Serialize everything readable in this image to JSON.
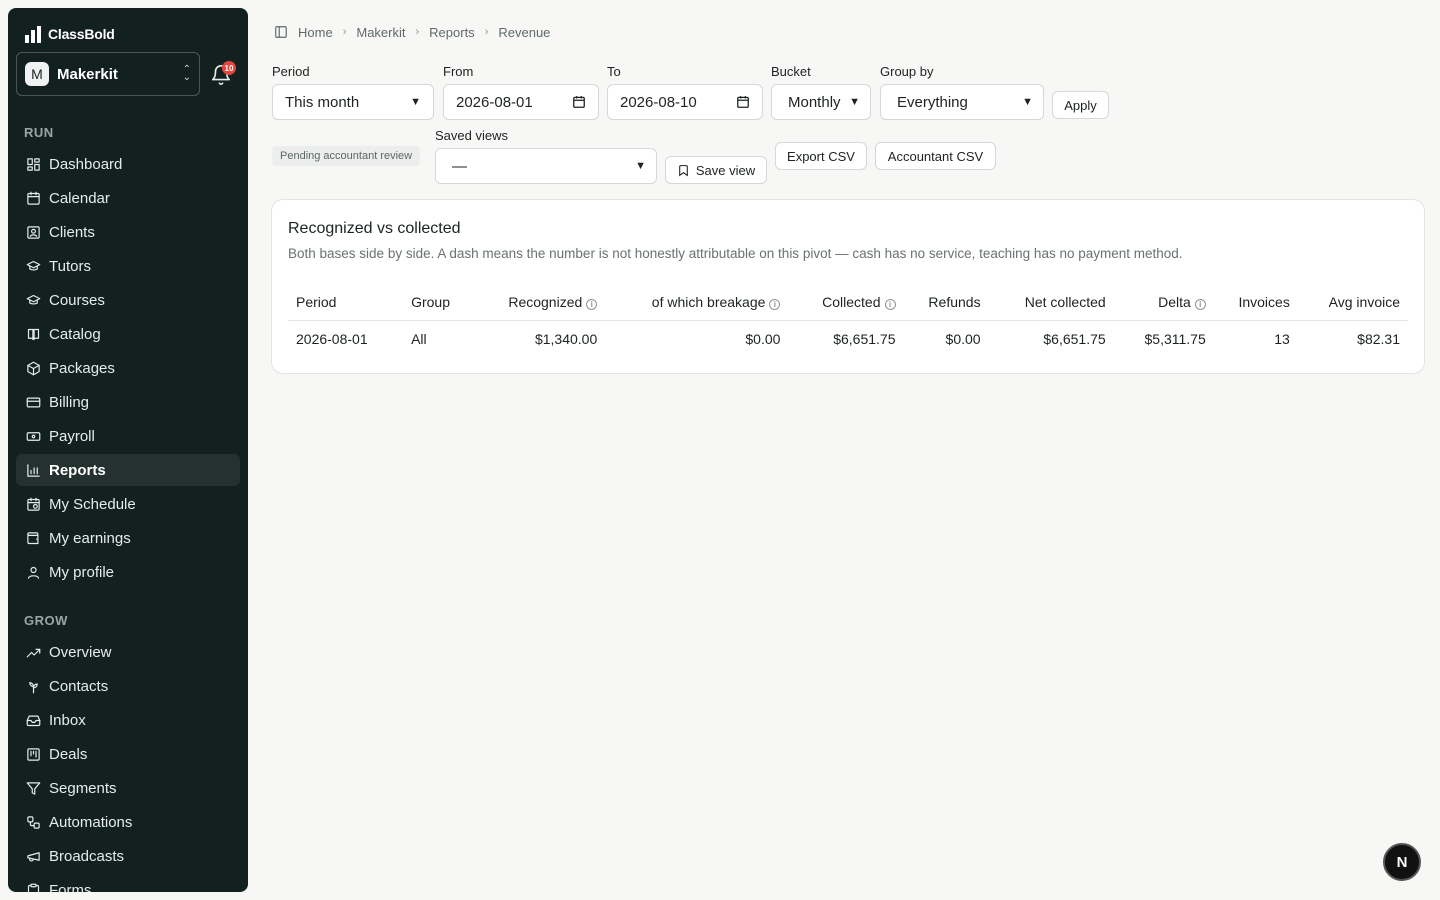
{
  "brand": {
    "name": "ClassBold"
  },
  "org": {
    "initial": "M",
    "name": "Makerkit"
  },
  "notifications": {
    "count": "10"
  },
  "sidebar": {
    "section_run": "RUN",
    "run_items": [
      {
        "label": "Dashboard",
        "icon": "dashboard-icon"
      },
      {
        "label": "Calendar",
        "icon": "calendar-icon"
      },
      {
        "label": "Clients",
        "icon": "contact-card-icon"
      },
      {
        "label": "Tutors",
        "icon": "graduation-cap-icon"
      },
      {
        "label": "Courses",
        "icon": "graduation-cap-icon"
      },
      {
        "label": "Catalog",
        "icon": "book-icon"
      },
      {
        "label": "Packages",
        "icon": "package-icon"
      },
      {
        "label": "Billing",
        "icon": "credit-card-icon"
      },
      {
        "label": "Payroll",
        "icon": "banknote-icon"
      },
      {
        "label": "Reports",
        "icon": "bar-chart-icon",
        "active": true
      },
      {
        "label": "My Schedule",
        "icon": "calendar-clock-icon"
      },
      {
        "label": "My earnings",
        "icon": "wallet-icon"
      },
      {
        "label": "My profile",
        "icon": "user-icon"
      }
    ],
    "section_grow": "GROW",
    "grow_items": [
      {
        "label": "Overview",
        "icon": "trending-up-icon"
      },
      {
        "label": "Contacts",
        "icon": "contacts-icon"
      },
      {
        "label": "Inbox",
        "icon": "inbox-icon"
      },
      {
        "label": "Deals",
        "icon": "kanban-icon"
      },
      {
        "label": "Segments",
        "icon": "filter-icon"
      },
      {
        "label": "Automations",
        "icon": "workflow-icon"
      },
      {
        "label": "Broadcasts",
        "icon": "megaphone-icon"
      },
      {
        "label": "Forms",
        "icon": "clipboard-icon"
      }
    ]
  },
  "breadcrumb": [
    "Home",
    "Makerkit",
    "Reports",
    "Revenue"
  ],
  "filters": {
    "period_label": "Period",
    "period_value": "This month",
    "from_label": "From",
    "from_value": "2026-08-01",
    "to_label": "To",
    "to_value": "2026-08-10",
    "bucket_label": "Bucket",
    "bucket_value": "Monthly",
    "groupby_label": "Group by",
    "groupby_value": "Everything",
    "apply_label": "Apply",
    "status_badge": "Pending accountant review",
    "saved_views_label": "Saved views",
    "saved_views_value": "—",
    "save_view_label": "Save view",
    "export_csv_label": "Export CSV",
    "accountant_csv_label": "Accountant CSV"
  },
  "card": {
    "title": "Recognized vs collected",
    "subtitle": "Both bases side by side. A dash means the number is not honestly attributable on this pivot — cash has no service, teaching has no payment method.",
    "columns": [
      "Period",
      "Group",
      "Recognized",
      "of which breakage",
      "Collected",
      "Refunds",
      "Net collected",
      "Delta",
      "Invoices",
      "Avg invoice"
    ],
    "rows": [
      [
        "2026-08-01",
        "All",
        "$1,340.00",
        "$0.00",
        "$6,651.75",
        "$0.00",
        "$6,651.75",
        "$5,311.75",
        "13",
        "$82.31"
      ]
    ]
  },
  "fab": {
    "label": "N"
  }
}
